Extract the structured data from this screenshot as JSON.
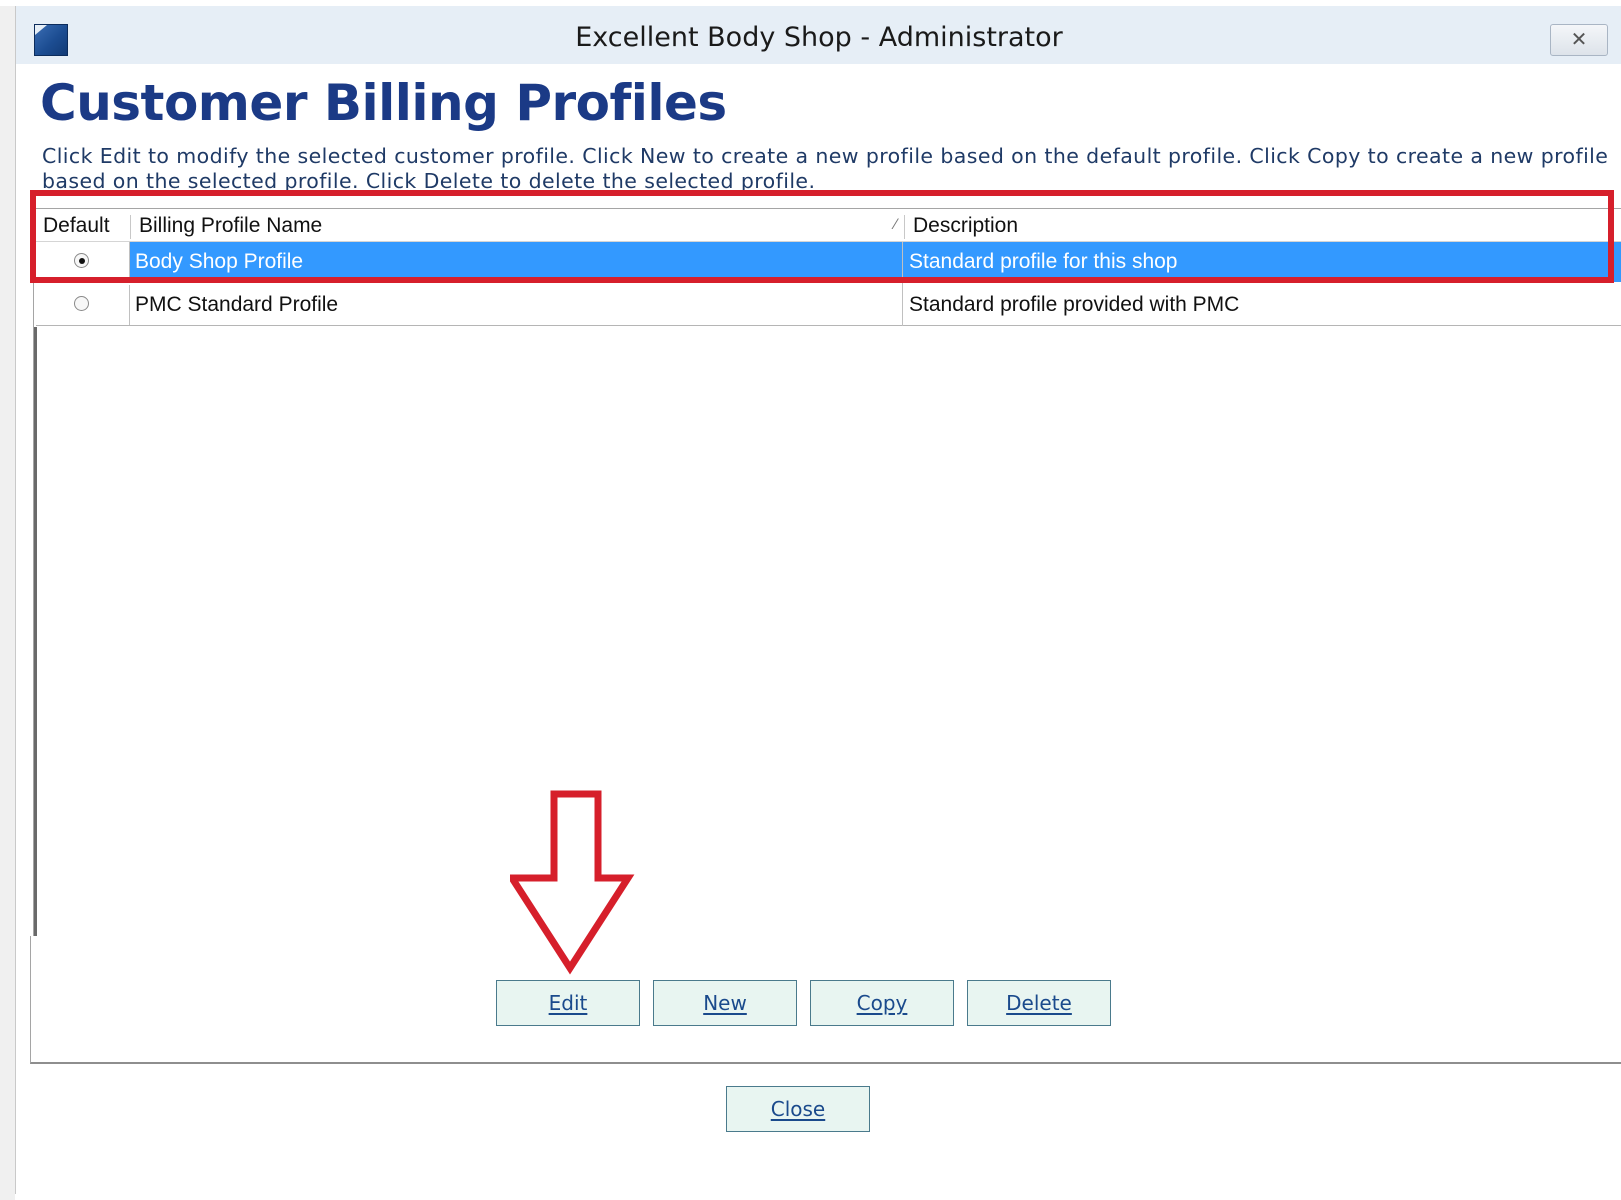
{
  "window": {
    "title": "Excellent Body Shop - Administrator",
    "close_icon": "close-icon"
  },
  "page": {
    "title": "Customer Billing Profiles",
    "instructions": "Click Edit to modify the selected customer profile.  Click New to create a new profile based on the default profile.  Click Copy to create a new profile based on the selected profile.  Click Delete to delete the selected profile."
  },
  "grid": {
    "columns": [
      "Default",
      "Billing Profile Name",
      "Description"
    ],
    "rows": [
      {
        "default": true,
        "name": "Body Shop Profile",
        "description": "Standard profile for this shop",
        "selected": true
      },
      {
        "default": false,
        "name": "PMC Standard Profile",
        "description": "Standard profile provided with PMC",
        "selected": false
      }
    ]
  },
  "buttons": {
    "edit": "Edit",
    "new": "New",
    "copy": "Copy",
    "delete": "Delete",
    "close": "Close"
  },
  "annotations": {
    "highlight_color": "#d61f2b",
    "arrow_color": "#d61f2b"
  },
  "colors": {
    "title_blue": "#1b3a86",
    "selection_blue": "#3399ff",
    "button_fill": "#e8f5f1"
  }
}
